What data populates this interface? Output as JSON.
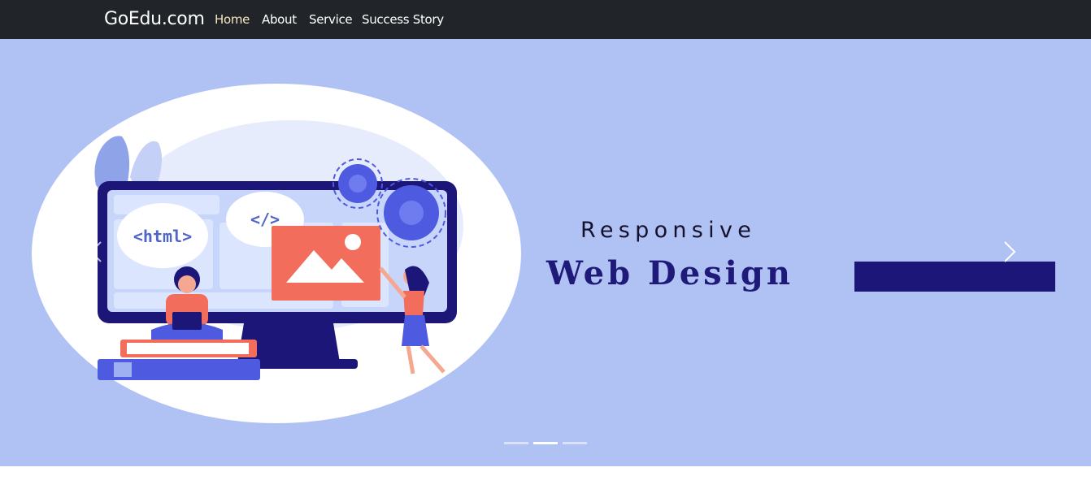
{
  "navbar": {
    "brand": "GoEdu.com",
    "links": [
      {
        "label": "Home",
        "active": true
      },
      {
        "label": "About",
        "active": false
      },
      {
        "label": "Service",
        "active": false
      },
      {
        "label": "Success Story",
        "active": false
      }
    ]
  },
  "carousel": {
    "slide": {
      "headline_line1": "Responsive",
      "headline_line2": "Web Design",
      "illustration": {
        "code_tags": [
          "<html>",
          "</>"
        ]
      }
    },
    "indicator_count": 3,
    "active_indicator": 2
  },
  "colors": {
    "navbar_bg": "#212529",
    "slide_bg": "#b0c1f3",
    "accent": "#1d1679"
  },
  "icons": {
    "prev": "chevron-left-icon",
    "next": "chevron-right-icon"
  }
}
